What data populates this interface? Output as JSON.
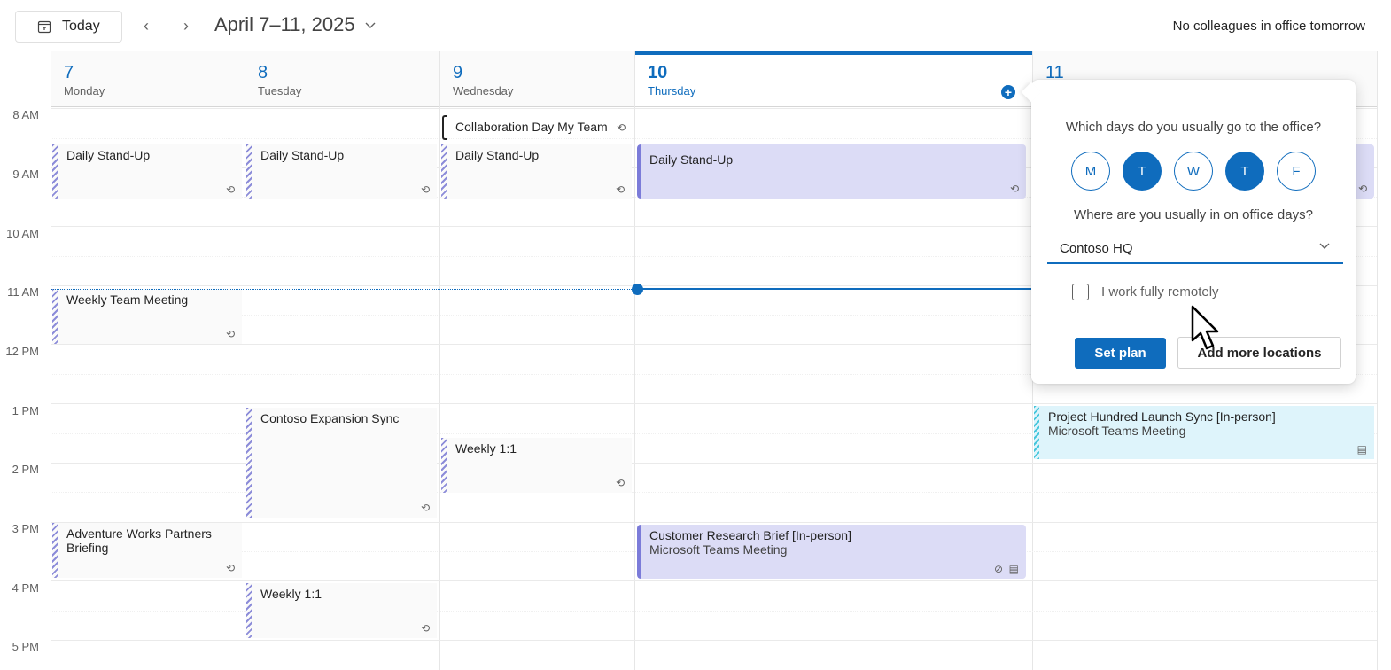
{
  "toolbar": {
    "today_label": "Today",
    "date_range": "April 7–11, 2025",
    "colleagues_status": "No colleagues in office tomorrow"
  },
  "days": [
    {
      "num": "7",
      "name": "Monday"
    },
    {
      "num": "8",
      "name": "Tuesday"
    },
    {
      "num": "9",
      "name": "Wednesday"
    },
    {
      "num": "10",
      "name": "Thursday"
    },
    {
      "num": "11",
      "name": ""
    }
  ],
  "times": [
    "8 AM",
    "9 AM",
    "10 AM",
    "11 AM",
    "12 PM",
    "1 PM",
    "2 PM",
    "3 PM",
    "4 PM",
    "5 PM"
  ],
  "events": {
    "allday_wed": "Collaboration Day My Team",
    "mon_standup": "Daily Stand-Up",
    "tue_standup": "Daily Stand-Up",
    "wed_standup": "Daily Stand-Up",
    "thu_standup": "Daily Stand-Up",
    "mon_weekly_team": "Weekly Team Meeting",
    "tue_contoso": "Contoso Expansion Sync",
    "wed_weekly": "Weekly 1:1",
    "fri_project": "Project Hundred Launch Sync [In-person]",
    "fri_project_sub": "Microsoft Teams Meeting",
    "mon_adventure": "Adventure Works Partners Briefing",
    "thu_customer": "Customer Research Brief [In-person]",
    "thu_customer_sub": "Microsoft Teams Meeting",
    "tue_weekly": "Weekly 1:1"
  },
  "popup": {
    "question_days": "Which days do you usually go to the office?",
    "weekdays": [
      {
        "label": "M",
        "selected": false
      },
      {
        "label": "T",
        "selected": true
      },
      {
        "label": "W",
        "selected": false
      },
      {
        "label": "T",
        "selected": true
      },
      {
        "label": "F",
        "selected": false
      }
    ],
    "question_location": "Where are you usually in on office days?",
    "location": "Contoso HQ",
    "remote_label": "I work fully remotely",
    "remote_checked": false,
    "set_plan": "Set plan",
    "add_locations": "Add more locations"
  },
  "colors": {
    "accent": "#0f6cbd",
    "event_purple": "#dcdcf6",
    "event_cyan": "#def4fb"
  }
}
